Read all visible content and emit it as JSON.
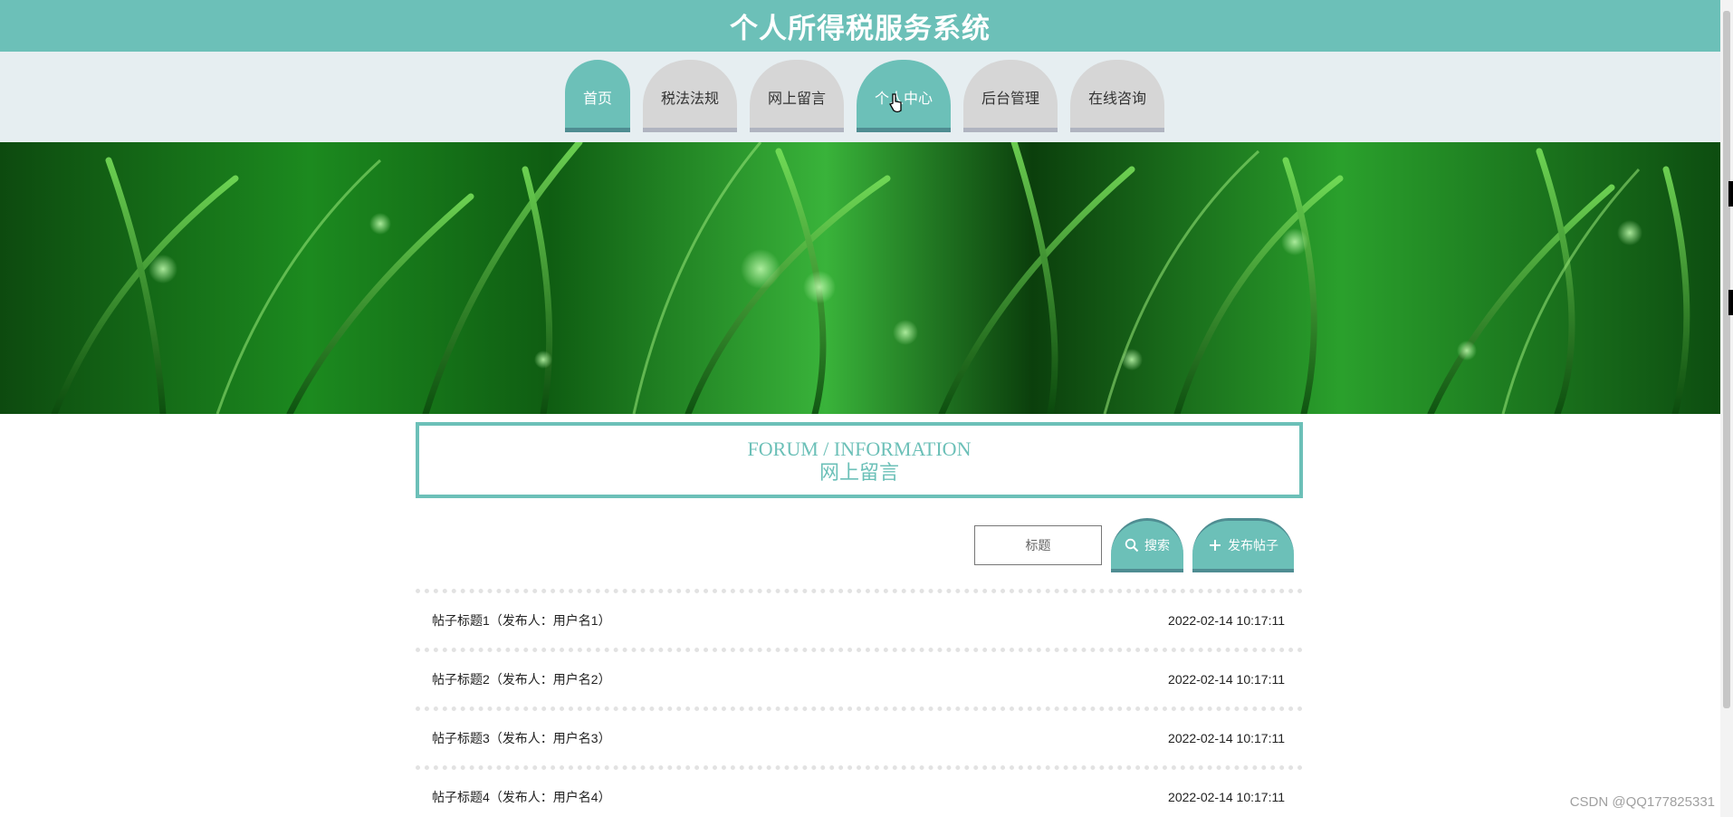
{
  "header": {
    "title": "个人所得税服务系统"
  },
  "nav": {
    "tabs": [
      {
        "label": "首页",
        "active": true
      },
      {
        "label": "税法法规",
        "active": false
      },
      {
        "label": "网上留言",
        "active": false
      },
      {
        "label": "个人中心",
        "active": true
      },
      {
        "label": "后台管理",
        "active": false
      },
      {
        "label": "在线咨询",
        "active": false
      }
    ]
  },
  "section": {
    "title_en": "FORUM / INFORMATION",
    "title_cn": "网上留言"
  },
  "search": {
    "placeholder": "标题",
    "search_label": "搜索",
    "post_label": "发布帖子"
  },
  "posts": [
    {
      "title": "帖子标题1（发布人：用户名1）",
      "time": "2022-02-14 10:17:11"
    },
    {
      "title": "帖子标题2（发布人：用户名2）",
      "time": "2022-02-14 10:17:11"
    },
    {
      "title": "帖子标题3（发布人：用户名3）",
      "time": "2022-02-14 10:17:11"
    },
    {
      "title": "帖子标题4（发布人：用户名4）",
      "time": "2022-02-14 10:17:11"
    }
  ],
  "watermark": "CSDN @QQ177825331",
  "colors": {
    "accent": "#6cc0b8",
    "accent_dark": "#4f8d92",
    "tab_inactive": "#d6d6d6",
    "nav_bg": "#e6eef1"
  }
}
